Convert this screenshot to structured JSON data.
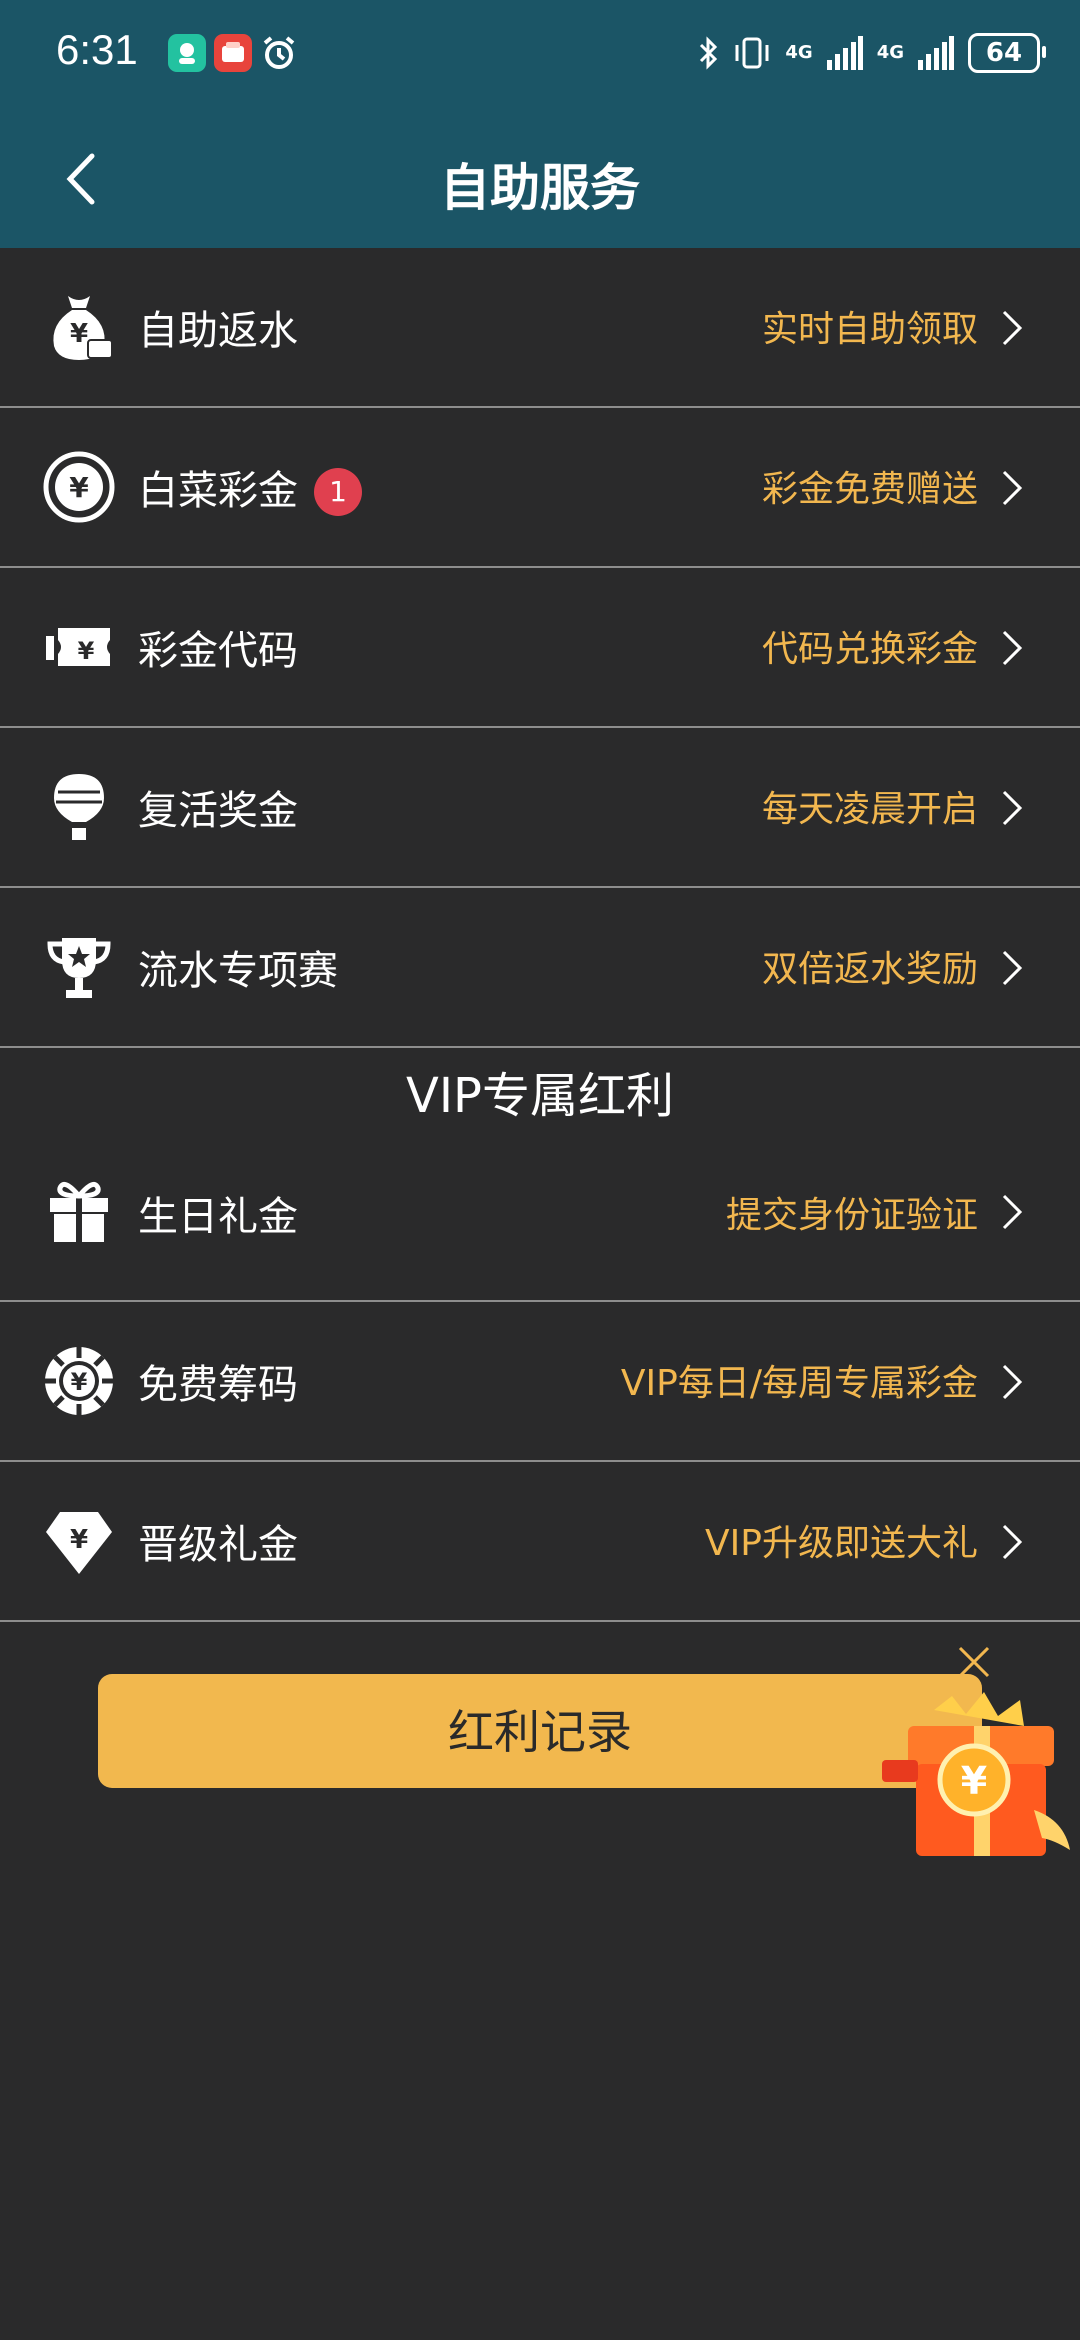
{
  "status_bar": {
    "time": "6:31",
    "net1": "4G",
    "net2": "4G",
    "battery": "64"
  },
  "header": {
    "title": "自助服务"
  },
  "menu": [
    {
      "label": "自助返水",
      "sub": "实时自助领取",
      "icon": "money-bag-icon"
    },
    {
      "label": "白菜彩金",
      "sub": "彩金免费赠送",
      "icon": "yuan-coin-icon",
      "badge": "1"
    },
    {
      "label": "彩金代码",
      "sub": "代码兑换彩金",
      "icon": "ticket-icon"
    },
    {
      "label": "复活奖金",
      "sub": "每天凌晨开启",
      "icon": "balloon-icon"
    },
    {
      "label": "流水专项赛",
      "sub": "双倍返水奖励",
      "icon": "trophy-icon"
    }
  ],
  "vip": {
    "title": "VIP专属红利",
    "items": [
      {
        "label": "生日礼金",
        "sub": "提交身份证验证",
        "icon": "gift-icon"
      },
      {
        "label": "免费筹码",
        "sub": "VIP每日/每周专属彩金",
        "icon": "chip-icon"
      },
      {
        "label": "晋级礼金",
        "sub": "VIP升级即送大礼",
        "icon": "diamond-icon"
      }
    ]
  },
  "record_button": "红利记录",
  "colors": {
    "header_bg": "#1b5566",
    "page_bg": "#2a2a2b",
    "accent": "#f2b74f",
    "badge": "#e0404f"
  }
}
